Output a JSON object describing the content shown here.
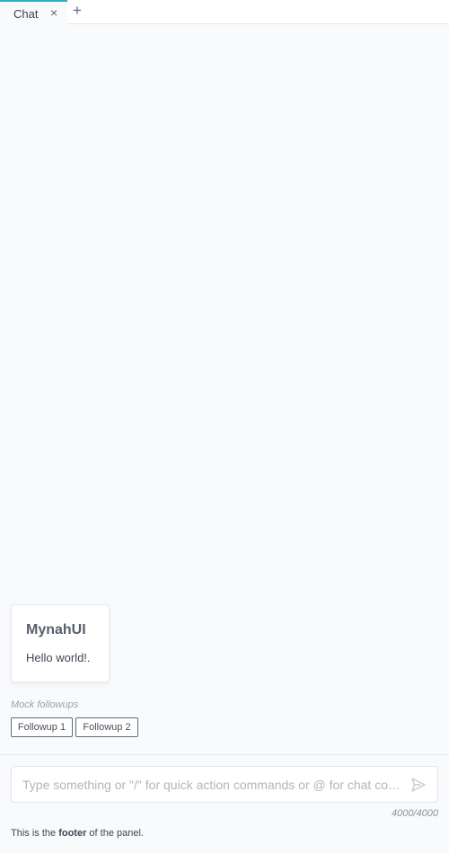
{
  "tabs": [
    {
      "label": "Chat",
      "close_glyph": "×"
    }
  ],
  "tab_add_glyph": "+",
  "message": {
    "title": "MynahUI",
    "body": "Hello world!."
  },
  "followups": {
    "title": "Mock followups",
    "items": [
      "Followup 1",
      "Followup 2"
    ]
  },
  "prompt": {
    "placeholder": "Type something or \"/\" for quick action commands or @ for chat context",
    "value": "",
    "char_count": "4000/4000"
  },
  "footer": {
    "prefix": "This is the ",
    "bold": "footer",
    "suffix": " of the panel."
  },
  "icons": {
    "tab_close": "close-icon",
    "tab_add": "plus-icon",
    "send": "send-icon"
  },
  "colors": {
    "accent": "#27b2c6",
    "background": "#f8fafc"
  }
}
